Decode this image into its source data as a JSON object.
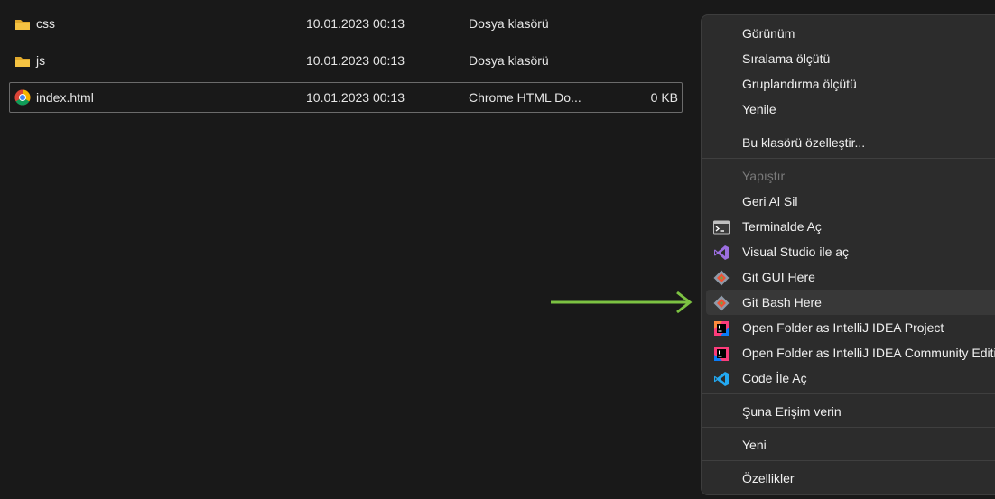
{
  "files": [
    {
      "name": "css",
      "date": "10.01.2023 00:13",
      "type": "Dosya klasörü",
      "size": "",
      "icon": "folder-icon"
    },
    {
      "name": "js",
      "date": "10.01.2023 00:13",
      "type": "Dosya klasörü",
      "size": "",
      "icon": "folder-icon"
    },
    {
      "name": "index.html",
      "date": "10.01.2023 00:13",
      "type": "Chrome HTML Do...",
      "size": "0 KB",
      "icon": "chrome-icon"
    }
  ],
  "context_menu": {
    "items": [
      {
        "label": "Görünüm"
      },
      {
        "label": "Sıralama ölçütü"
      },
      {
        "label": "Gruplandırma ölçütü"
      },
      {
        "label": "Yenile"
      },
      {
        "label": "Bu klasörü özelleştir..."
      },
      {
        "label": "Yapıştır",
        "disabled": true
      },
      {
        "label": "Geri Al Sil"
      },
      {
        "label": "Terminalde Aç",
        "icon": "terminal-icon"
      },
      {
        "label": "Visual Studio ile aç",
        "icon": "visual-studio-icon"
      },
      {
        "label": "Git GUI Here",
        "icon": "git-icon"
      },
      {
        "label": "Git Bash Here",
        "icon": "git-icon",
        "highlighted": true
      },
      {
        "label": "Open Folder as IntelliJ IDEA Project",
        "icon": "intellij-idea-icon"
      },
      {
        "label": "Open Folder as IntelliJ IDEA Community Edition Project",
        "icon": "intellij-community-icon"
      },
      {
        "label": "Code İle Aç",
        "icon": "vscode-icon"
      },
      {
        "label": "Şuna Erişim verin"
      },
      {
        "label": "Yeni"
      },
      {
        "label": "Özellikler"
      }
    ]
  },
  "annotation": {
    "arrow_color": "#7cc242"
  },
  "colors": {
    "background": "#191919",
    "menu_background": "#2c2c2c",
    "folder": "#f5c342"
  }
}
